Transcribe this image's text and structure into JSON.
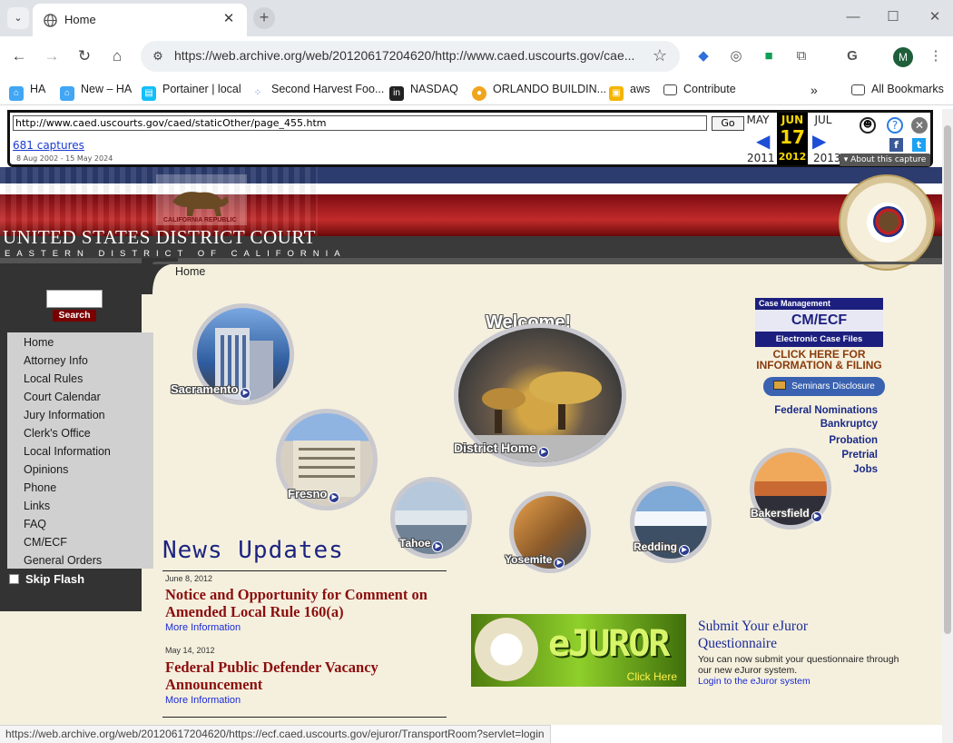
{
  "browser": {
    "tab_title": "Home",
    "url": "https://web.archive.org/web/20120617204620/http://www.caed.uscourts.gov/cae...",
    "avatar_initial": "M",
    "bookmarks": [
      "HA",
      "New – HA",
      "Portainer | local",
      "Second Harvest Foo...",
      "NASDAQ",
      "ORLANDO BUILDIN...",
      "aws",
      "Contribute"
    ],
    "all_bookmarks": "All Bookmarks",
    "status_url": "https://web.archive.org/web/20120617204620/https://ecf.caed.uscourts.gov/ejuror/TransportRoom?servlet=login"
  },
  "wayback": {
    "url_value": "http://www.caed.uscourts.gov/caed/staticOther/page_455.htm",
    "go": "Go",
    "captures": "681 captures",
    "range": "8 Aug 2002 - 15 May 2024",
    "prev_month": "MAY",
    "cur_month": "JUN",
    "next_month": "JUL",
    "cur_day": "17",
    "prev_year": "2011",
    "cur_year": "2012",
    "next_year": "2013",
    "about": "About this capture"
  },
  "site": {
    "title": "UNITED STATES DISTRICT COURT",
    "subtitle": "EASTERN DISTRICT OF CALIFORNIA",
    "breadcrumb": "Home",
    "search_label": "Search",
    "menu": [
      "Home",
      "Attorney Info",
      "Local Rules",
      "Court Calendar",
      "Jury Information",
      "Clerk's Office",
      "Local Information",
      "Opinions",
      "Phone",
      "Links",
      "FAQ",
      "CM/ECF",
      "General Orders"
    ],
    "skip_flash": "Skip Flash",
    "bubbles": {
      "welcome": "Welcome!",
      "sacramento": "Sacramento",
      "district_home": "District Home",
      "fresno": "Fresno",
      "tahoe": "Tahoe",
      "yosemite": "Yosemite",
      "redding": "Redding",
      "bakersfield": "Bakersfield"
    },
    "cmecf": {
      "line1": "Case Management",
      "line2": "CM/ECF",
      "line3": "Electronic Case Files",
      "link": "CLICK HERE FOR INFORMATION & FILING"
    },
    "seminars": "Seminars Disclosure",
    "right_links": [
      "Federal Nominations",
      "Bankruptcy",
      "Probation",
      "Pretrial",
      "Jobs"
    ],
    "news_title": "News Updates",
    "news": [
      {
        "date": "June 8, 2012",
        "headline": "Notice and Opportunity for Comment on Amended Local Rule 160(a)",
        "more": "More Information"
      },
      {
        "date": "May 14, 2012",
        "headline": "Federal Public Defender Vacancy Announcement",
        "more": "More Information"
      }
    ],
    "ejuror": {
      "banner_word": "eJUROR",
      "banner_click": "Click Here",
      "title": "Submit Your eJuror Questionnaire",
      "text": "You can now submit your questionnaire through our new eJuror system.",
      "link": "Login to the eJuror system"
    }
  }
}
